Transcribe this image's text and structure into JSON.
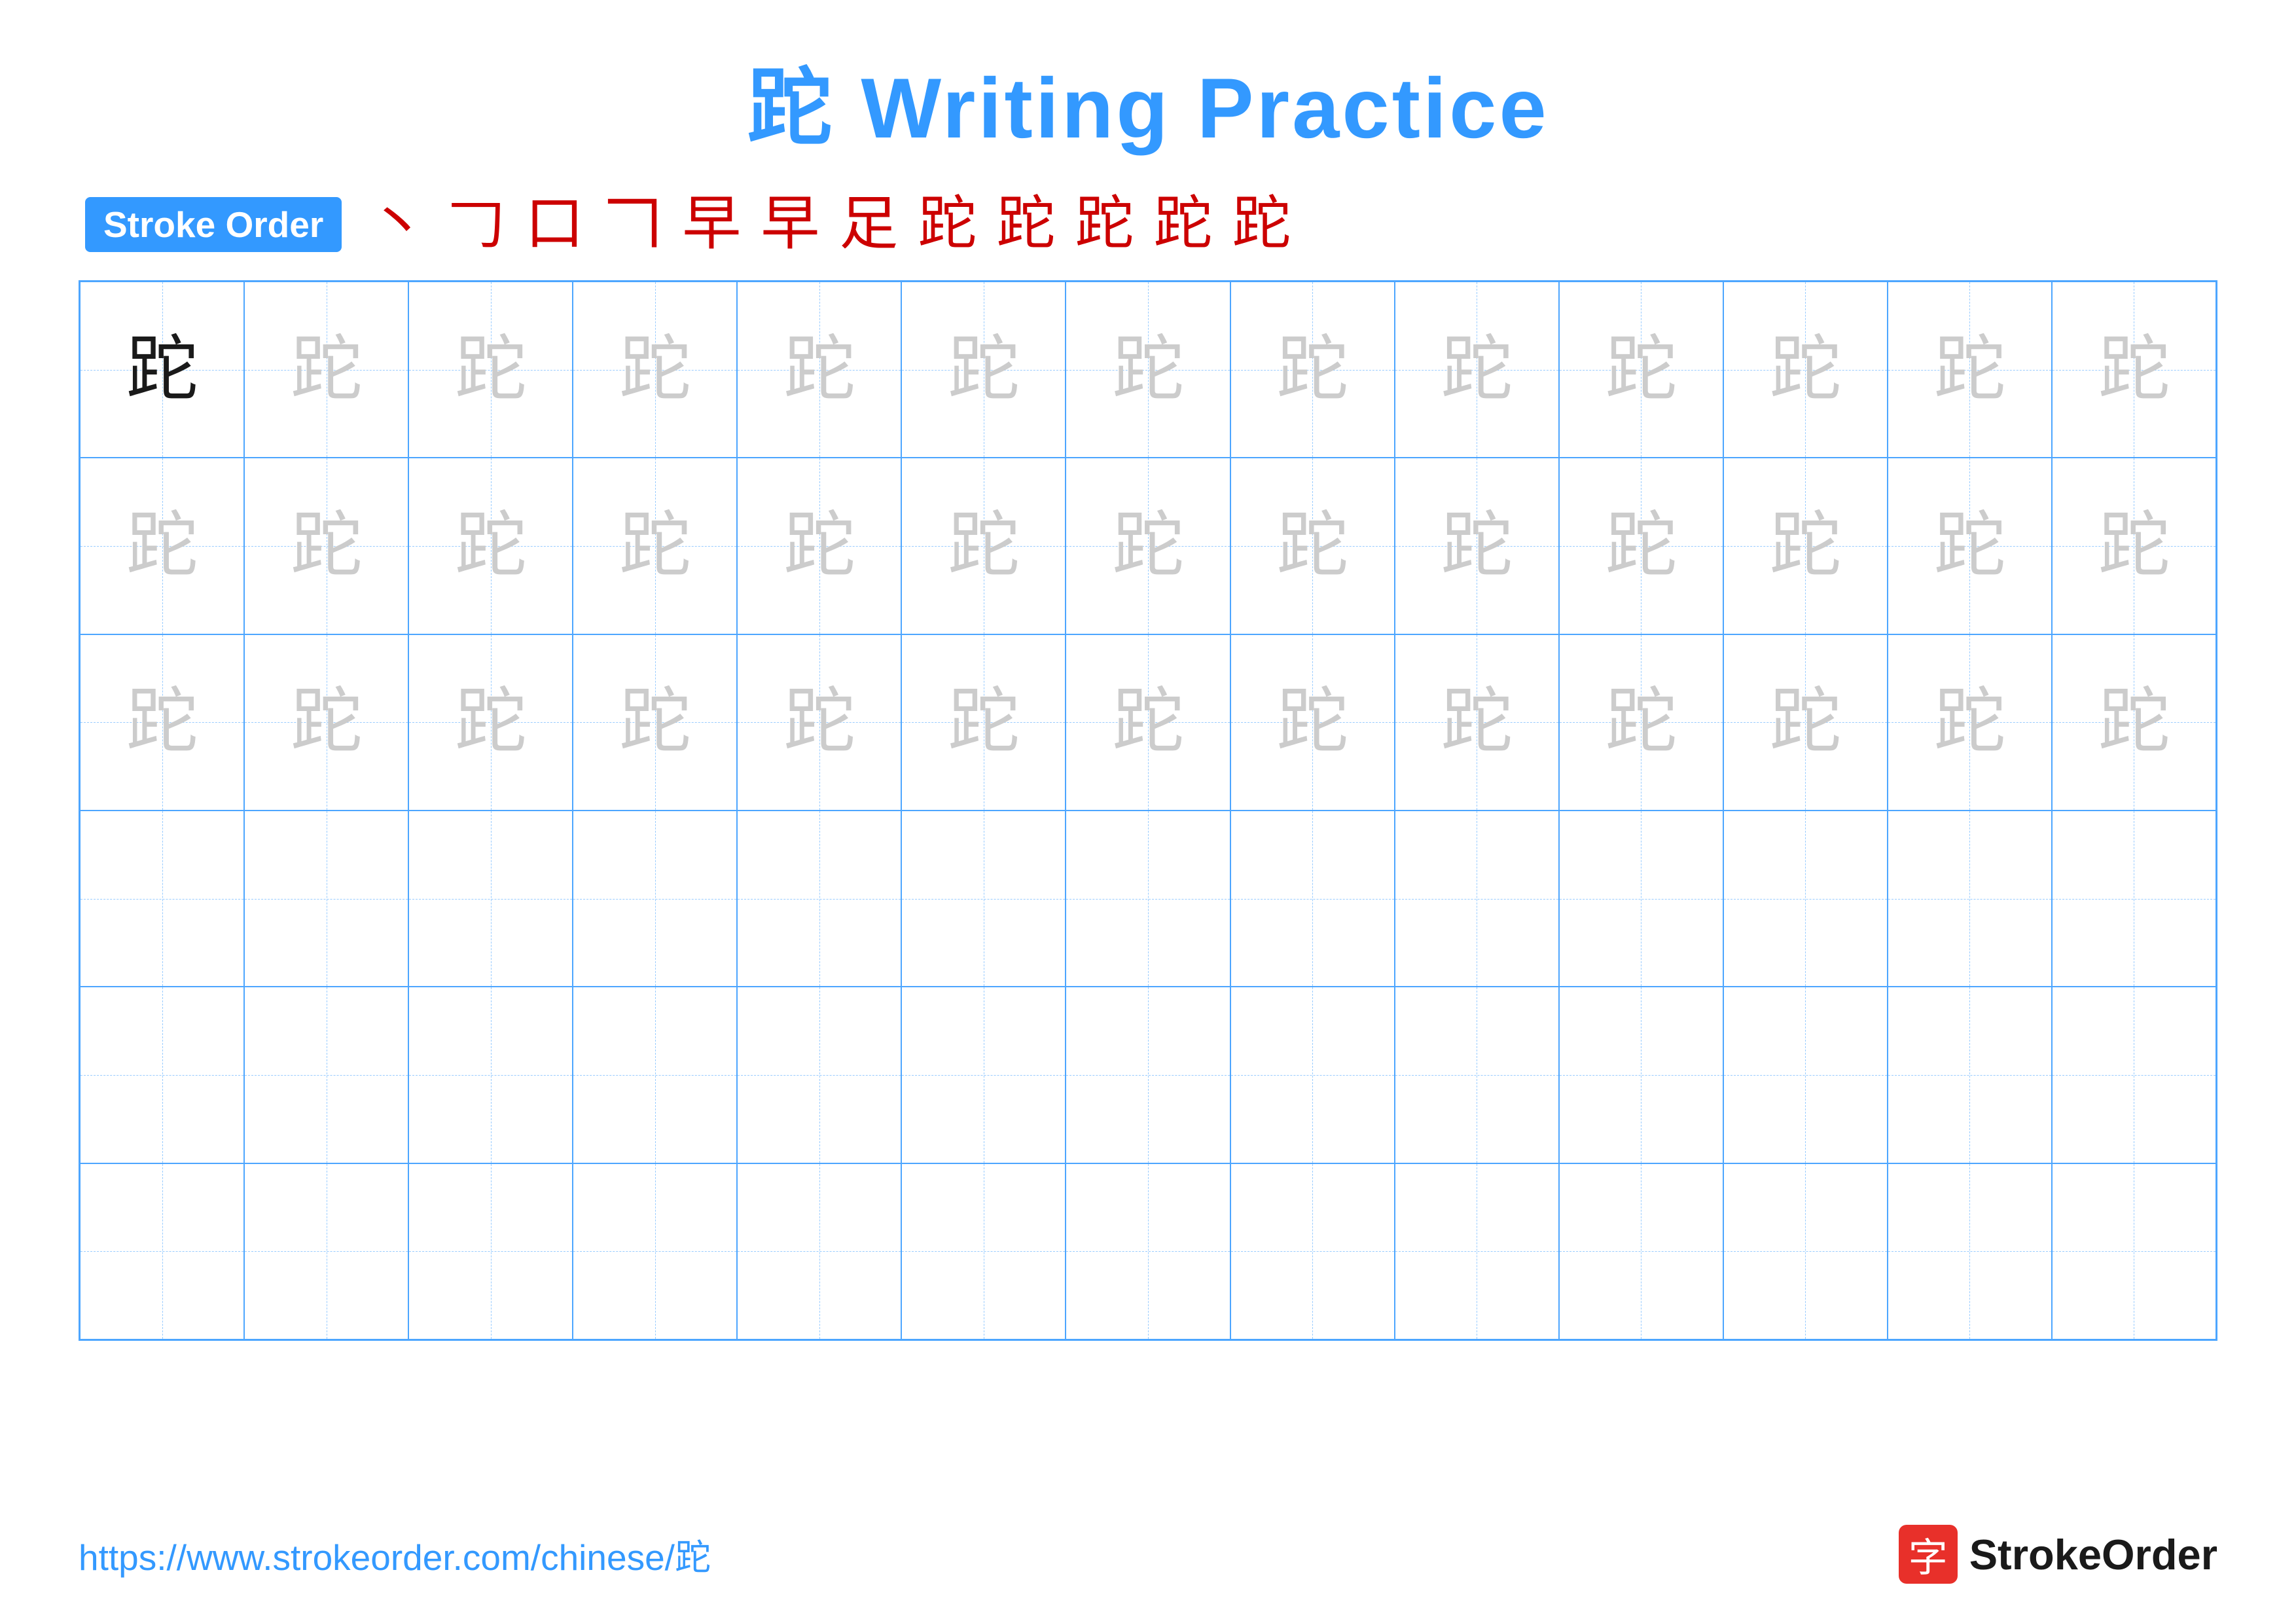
{
  "title": "跎 Writing Practice",
  "stroke_order": {
    "badge_label": "Stroke Order",
    "steps": [
      "丶",
      "𠃌",
      "口",
      "𠃍",
      "早",
      "早",
      "足",
      "跎",
      "跎",
      "跎",
      "跎",
      "跎"
    ]
  },
  "character": "跎",
  "grid": {
    "cols": 13,
    "rows": 6,
    "row1_first_dark": true,
    "row1_count": 13,
    "row2_count": 13,
    "row3_count": 13
  },
  "footer": {
    "url": "https://www.strokeorder.com/chinese/跎",
    "logo_char": "字",
    "logo_text": "StrokeOrder"
  },
  "colors": {
    "blue": "#3399ff",
    "red": "#cc0000",
    "dark": "#1a1a1a",
    "light": "#cccccc",
    "grid_border": "#4da6ff",
    "grid_dashed": "#99ccff"
  }
}
